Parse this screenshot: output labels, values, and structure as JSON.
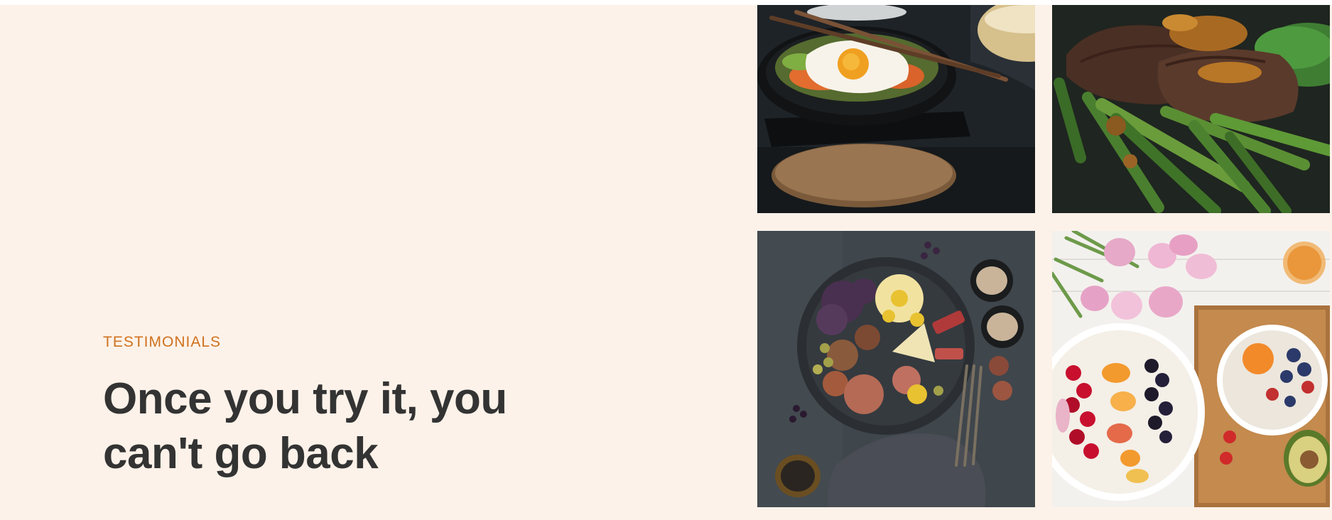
{
  "testimonials": {
    "subheading": "Testimonials",
    "heading_line1": "Once you try it, you",
    "heading_line2": "can't go back"
  },
  "gallery": {
    "images": [
      {
        "icon": "bibimbap-photo"
      },
      {
        "icon": "steak-asparagus-photo"
      },
      {
        "icon": "grazing-platter-photo"
      },
      {
        "icon": "fruit-bowl-photo"
      }
    ]
  },
  "colors": {
    "background": "#fdf2e9",
    "accent": "#cf711f",
    "heading": "#333333"
  }
}
